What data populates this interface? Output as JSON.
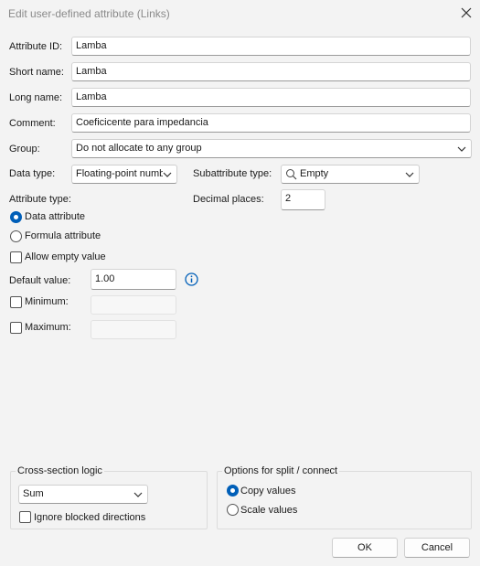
{
  "window": {
    "title": "Edit user-defined attribute (Links)"
  },
  "fields": {
    "attribute_id": {
      "label": "Attribute ID:",
      "value": "Lamba"
    },
    "short_name": {
      "label": "Short name:",
      "value": "Lamba"
    },
    "long_name": {
      "label": "Long name:",
      "value": "Lamba"
    },
    "comment": {
      "label": "Comment:",
      "value": "Coeficicente para impedancia"
    },
    "group": {
      "label": "Group:",
      "value": "Do not allocate to any group"
    },
    "data_type": {
      "label": "Data type:",
      "value": "Floating-point numb"
    },
    "subattribute_type": {
      "label": "Subattribute type:",
      "value": "Empty",
      "icon": "search-icon"
    },
    "decimal_places": {
      "label": "Decimal places:",
      "value": "2"
    }
  },
  "attribute_type": {
    "label": "Attribute type:",
    "options": [
      {
        "label": "Data attribute",
        "selected": true
      },
      {
        "label": "Formula attribute",
        "selected": false
      }
    ]
  },
  "allow_empty": {
    "label": "Allow empty value",
    "checked": false
  },
  "default_value": {
    "label": "Default value:",
    "value": "1.00",
    "info_icon": "info-icon"
  },
  "minimum": {
    "label": "Minimum:",
    "checked": false,
    "value": ""
  },
  "maximum": {
    "label": "Maximum:",
    "checked": false,
    "value": ""
  },
  "cross_section": {
    "title": "Cross-section logic",
    "select_value": "Sum",
    "ignore_blocked": {
      "label": "Ignore blocked directions",
      "checked": false
    }
  },
  "split_connect": {
    "title": "Options for split / connect",
    "options": [
      {
        "label": "Copy values",
        "selected": true
      },
      {
        "label": "Scale values",
        "selected": false
      }
    ]
  },
  "buttons": {
    "ok": "OK",
    "cancel": "Cancel"
  },
  "colors": {
    "accent": "#005fb8",
    "background": "#f3f3f3"
  }
}
